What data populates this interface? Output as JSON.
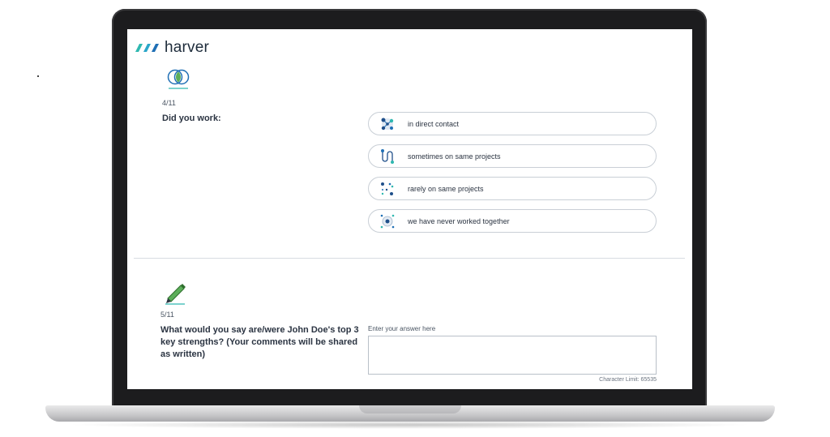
{
  "brand": {
    "name": "harver",
    "accent_teal": "#2fb8b0",
    "accent_blue": "#1f6fb5",
    "text_dark": "#2b3442"
  },
  "questions": [
    {
      "icon": "venn-circles-icon",
      "counter": "4/11",
      "text": "Did you work:",
      "options": [
        {
          "icon": "network-nodes-icon",
          "label": "in direct contact"
        },
        {
          "icon": "path-connector-icon",
          "label": "sometimes on same projects"
        },
        {
          "icon": "scattered-dots-icon",
          "label": "rarely on same projects"
        },
        {
          "icon": "target-dots-icon",
          "label": "we have never worked together"
        }
      ]
    },
    {
      "icon": "pencil-icon",
      "counter": "5/11",
      "text": "What would you say are/were John Doe's top 3 key strengths? (Your comments will be shared as written)",
      "answer_label": "Enter your answer here",
      "answer_value": "",
      "char_limit": "Character Limit: 65535"
    }
  ]
}
